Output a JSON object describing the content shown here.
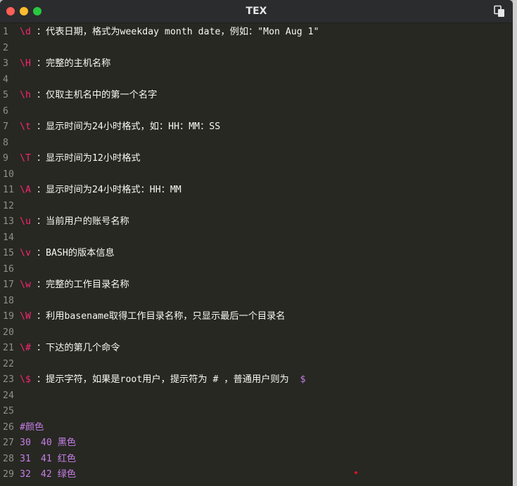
{
  "window": {
    "title": "TEX",
    "lights": {
      "close": "#ff5f57",
      "minimize": "#febc2e",
      "maximize": "#28c840"
    },
    "copy_icon": "copy-icon"
  },
  "lines": [
    {
      "n": "1",
      "code": "\\d",
      "text": "：代表日期，格式为weekday month date，例如：\"Mon Aug 1\""
    },
    {
      "n": "2"
    },
    {
      "n": "3",
      "code": "\\H",
      "text": "：完整的主机名称"
    },
    {
      "n": "4"
    },
    {
      "n": "5",
      "code": "\\h",
      "text": "：仅取主机名中的第一个名字"
    },
    {
      "n": "6"
    },
    {
      "n": "7",
      "code": "\\t",
      "text": "：显示时间为24小时格式，如：HH：MM：SS"
    },
    {
      "n": "8"
    },
    {
      "n": "9",
      "code": "\\T",
      "text": "：显示时间为12小时格式"
    },
    {
      "n": "10"
    },
    {
      "n": "11",
      "code": "\\A",
      "text": "：显示时间为24小时格式：HH：MM"
    },
    {
      "n": "12"
    },
    {
      "n": "13",
      "code": "\\u",
      "text": "：当前用户的账号名称"
    },
    {
      "n": "14"
    },
    {
      "n": "15",
      "code": "\\v",
      "text": "：BASH的版本信息"
    },
    {
      "n": "16"
    },
    {
      "n": "17",
      "code": "\\w",
      "text": "：完整的工作目录名称"
    },
    {
      "n": "18"
    },
    {
      "n": "19",
      "code": "\\W",
      "text": "：利用basename取得工作目录名称，只显示最后一个目录名"
    },
    {
      "n": "20"
    },
    {
      "n": "21",
      "code": "\\#",
      "text": "：下达的第几个命令"
    },
    {
      "n": "22"
    },
    {
      "n": "23",
      "code": "\\$",
      "text": "：提示字符，如果是root用户，提示符为 # ，普通用户则为 ",
      "tail": "$"
    },
    {
      "n": "24"
    },
    {
      "n": "25"
    },
    {
      "n": "26",
      "comment": "#颜色"
    },
    {
      "n": "27",
      "fg": "30",
      "bg": "40",
      "name": "黑色"
    },
    {
      "n": "28",
      "fg": "31",
      "bg": "41",
      "name": "红色"
    },
    {
      "n": "29",
      "fg": "32",
      "bg": "42",
      "name": "绿色"
    }
  ]
}
